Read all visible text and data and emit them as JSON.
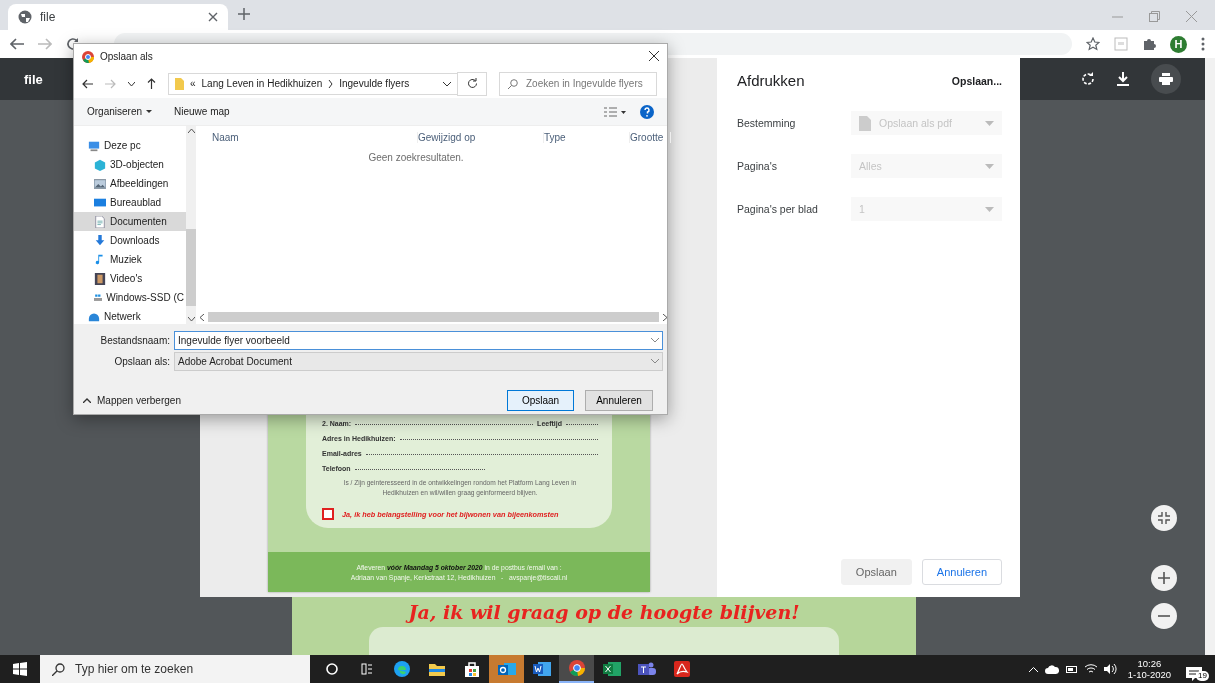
{
  "browser": {
    "tab": {
      "title": "file"
    },
    "avatar": "H"
  },
  "pdf_viewer": {
    "title": "file",
    "next_page_heading": "Ja, ik wil graag op de hoogte blijven!"
  },
  "print_panel": {
    "title": "Afdrukken",
    "summary": "Opslaan...",
    "settings": [
      {
        "label": "Bestemming",
        "value": "Opslaan als pdf",
        "kind": "destination",
        "disabled": true
      },
      {
        "label": "Pagina's",
        "value": "Alles",
        "kind": "select",
        "disabled": true
      },
      {
        "label": "Pagina's per blad",
        "value": "1",
        "kind": "select",
        "disabled": true
      }
    ],
    "buttons": [
      {
        "label": "Opslaan",
        "kind": "primary",
        "disabled": true
      },
      {
        "label": "Annuleren",
        "kind": "secondary",
        "disabled": false
      }
    ]
  },
  "flyer": {
    "rows": [
      {
        "label": "2.  Naam:",
        "extra_label": "Leeftijd",
        "short": false
      },
      {
        "label": "Adres in Hedikhuizen:",
        "short": false
      },
      {
        "label": "Email-adres",
        "short": false
      },
      {
        "label": "Telefoon",
        "short": true
      }
    ],
    "note": "Is / Zijn geinteresseerd in de ontwikkelingen rondom het Platform Lang Leven in Hedikhuizen en wil/willen graag geinformeerd blijven.",
    "checkbox": {
      "label": "Ja, ik heb belangstelling voor het bijwonen van bijeenkomsten",
      "checked": false
    },
    "footer": [
      "Afleveren **vóór Maandag 5 oktober 2020** in de postbus /email van :",
      "Adriaan van Spanje, Kerkstraat 12, Hedikhuizen   -   avspanje@tiscali.nl"
    ]
  },
  "save_dialog": {
    "title": "Opslaan als",
    "path_overflow": "«",
    "path": [
      "Lang Leven in Hedikhuizen",
      "Ingevulde flyers"
    ],
    "search": {
      "placeholder": "Zoeken in Ingevulde flyers"
    },
    "toolbar": [
      {
        "label": "Organiseren",
        "dropdown": true
      },
      {
        "label": "Nieuwe map",
        "dropdown": false
      }
    ],
    "nav": [
      {
        "label": "Deze pc",
        "selected": false,
        "children": [
          {
            "label": "3D-objecten",
            "selected": false
          },
          {
            "label": "Afbeeldingen",
            "selected": false
          },
          {
            "label": "Bureaublad",
            "selected": false
          },
          {
            "label": "Documenten",
            "selected": true
          },
          {
            "label": "Downloads",
            "selected": false
          },
          {
            "label": "Muziek",
            "selected": false
          },
          {
            "label": "Video's",
            "selected": false
          },
          {
            "label": "Windows-SSD (C",
            "selected": false
          }
        ]
      },
      {
        "label": "Netwerk",
        "selected": false
      }
    ],
    "columns": [
      "Naam",
      "Gewijzigd op",
      "Type",
      "Grootte"
    ],
    "empty_message": "Geen zoekresultaten.",
    "fields": [
      {
        "label": "Bestandsnaam:",
        "value": "Ingevulde flyer voorbeeld",
        "focused": true
      },
      {
        "label": "Opslaan als:",
        "value": "Adobe Acrobat Document",
        "focused": false
      }
    ],
    "hide_folders": "Mappen verbergen",
    "buttons": [
      {
        "label": "Opslaan",
        "kind": "primary"
      },
      {
        "label": "Annuleren",
        "kind": "secondary"
      }
    ]
  },
  "taskbar": {
    "search": {
      "placeholder": "Typ hier om te zoeken"
    },
    "apps": [
      {
        "kind": "cortana",
        "active": false,
        "attention": false
      },
      {
        "kind": "taskview",
        "active": false,
        "attention": false
      },
      {
        "kind": "edge",
        "active": false,
        "attention": false
      },
      {
        "kind": "explorer",
        "active": false,
        "attention": false
      },
      {
        "kind": "store",
        "active": false,
        "attention": false
      },
      {
        "kind": "outlook",
        "active": false,
        "attention": true
      },
      {
        "kind": "word",
        "active": false,
        "attention": false
      },
      {
        "kind": "chrome",
        "active": true,
        "attention": false
      },
      {
        "kind": "excel",
        "active": false,
        "attention": false
      },
      {
        "kind": "teams",
        "active": false,
        "attention": false
      },
      {
        "kind": "acrobat",
        "active": false,
        "attention": false
      }
    ],
    "time": "10:26",
    "date": "1-10-2020",
    "notifications": "19"
  }
}
